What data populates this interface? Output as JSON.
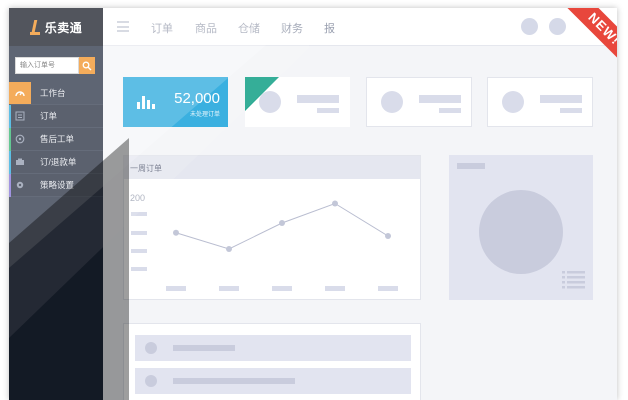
{
  "app": {
    "name": "乐卖通"
  },
  "search": {
    "placeholder": "输入订单号"
  },
  "nav": [
    {
      "label": "工作台",
      "icon": "dashboard-icon",
      "active": true,
      "edge": "#f08d1c"
    },
    {
      "label": "订单",
      "icon": "list-icon",
      "active": false,
      "edge": "#1fa6dc"
    },
    {
      "label": "售后工单",
      "icon": "chat-icon",
      "active": false,
      "edge": "#27b36a"
    },
    {
      "label": "订/退款单",
      "icon": "money-icon",
      "active": false,
      "edge": "#1fa6dc"
    },
    {
      "label": "策略设置",
      "icon": "gear-icon",
      "active": false,
      "edge": "#7d6bd6"
    }
  ],
  "header": {
    "menu": [
      "订单",
      "商品",
      "仓储",
      "财务",
      "报"
    ]
  },
  "stats": {
    "primary_value": "52,000",
    "primary_label": "未处理订单"
  },
  "chart": {
    "title": "一周订单"
  },
  "chart_data": {
    "type": "line",
    "title": "一周订单",
    "yticks": [
      "200"
    ],
    "series": [
      {
        "values": [
          0.45,
          0.2,
          0.6,
          0.9,
          0.4
        ]
      }
    ]
  },
  "badge": {
    "text": "NEW!"
  },
  "colors": {
    "accent": "#f08d1c",
    "primary": "#1fa6dc",
    "sidebar": "#202a3d",
    "badge": "#e8473c"
  }
}
